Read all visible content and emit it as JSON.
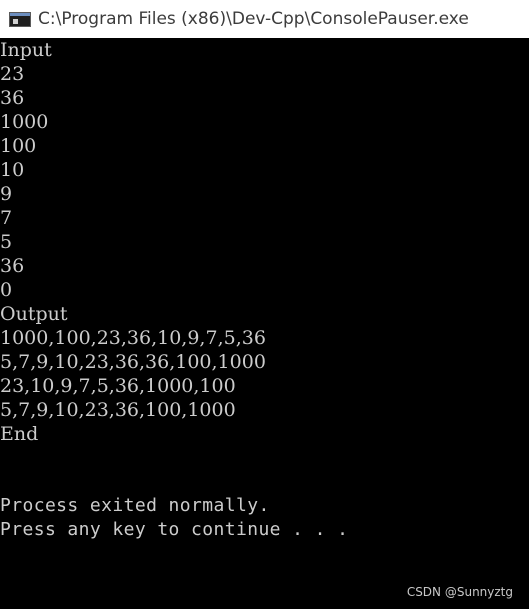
{
  "window": {
    "title": "C:\\Program Files (x86)\\Dev-Cpp\\ConsolePauser.exe",
    "icon": "console-app-icon"
  },
  "console": {
    "lines": [
      "Input",
      "23",
      "36",
      "1000",
      "100",
      "10",
      "9",
      "7",
      "5",
      "36",
      "0",
      "Output",
      "1000,100,23,36,10,9,7,5,36",
      "5,7,9,10,23,36,36,100,1000",
      "23,10,9,7,5,36,1000,100",
      "5,7,9,10,23,36,100,1000",
      "End"
    ],
    "status_line": "Process exited normally.",
    "prompt_line": "Press any key to continue . . ."
  },
  "watermark": "CSDN @Sunnyztg",
  "colors": {
    "console_background": "#000000",
    "console_text": "#cccccc",
    "titlebar_background": "#ffffff"
  }
}
